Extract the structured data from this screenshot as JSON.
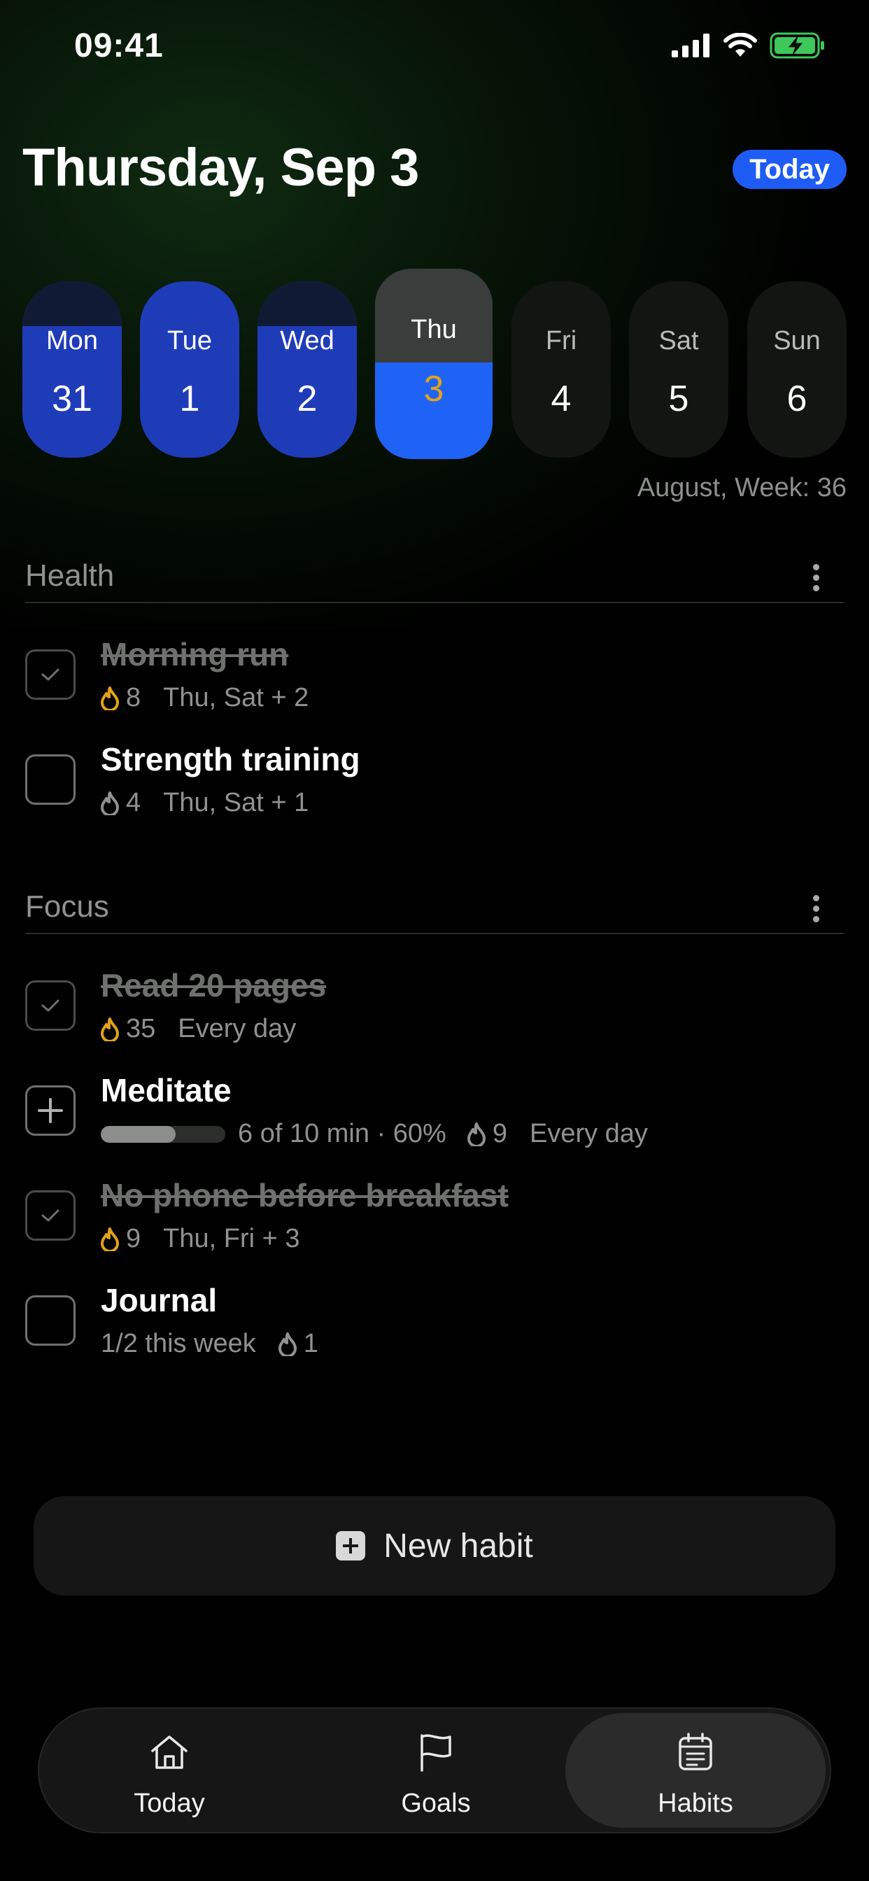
{
  "status_bar": {
    "time": "09:41"
  },
  "header": {
    "title": "Thursday, Sep 3",
    "today_button": "Today"
  },
  "week": {
    "days": [
      {
        "name": "Mon",
        "num": "31",
        "state": "done"
      },
      {
        "name": "Tue",
        "num": "1",
        "state": "done"
      },
      {
        "name": "Wed",
        "num": "2",
        "state": "done"
      },
      {
        "name": "Thu",
        "num": "3",
        "state": "selected"
      },
      {
        "name": "Fri",
        "num": "4",
        "state": "future"
      },
      {
        "name": "Sat",
        "num": "5",
        "state": "future"
      },
      {
        "name": "Sun",
        "num": "6",
        "state": "future"
      }
    ],
    "label": "August, Week: 36"
  },
  "sections": [
    {
      "title": "Health",
      "habits": [
        {
          "name": "Morning run",
          "done": true,
          "streak": "8",
          "schedule": "Thu, Sat + 2"
        },
        {
          "name": "Strength training",
          "done": false,
          "streak": "4",
          "schedule": "Thu, Sat + 1"
        }
      ]
    },
    {
      "title": "Focus",
      "habits": [
        {
          "name": "Read 20 pages",
          "done": true,
          "streak": "35",
          "schedule": "Every day"
        },
        {
          "name": "Meditate",
          "done": false,
          "progress_text": "6 of 10 min · 60%",
          "progress": 0.6,
          "streak": "9",
          "schedule": "Every day"
        },
        {
          "name": "No phone before breakfast",
          "done": true,
          "streak": "9",
          "schedule": "Thu, Fri + 3"
        },
        {
          "name": "Journal",
          "done": false,
          "weekly": "1/2 this week",
          "streak": "1"
        }
      ]
    }
  ],
  "new_habit_button": "New habit",
  "tabbar": {
    "tabs": [
      {
        "label": "Today",
        "icon": "home-icon"
      },
      {
        "label": "Goals",
        "icon": "flag-icon"
      },
      {
        "label": "Habits",
        "icon": "calendar-list-icon",
        "active": true
      }
    ]
  },
  "colors": {
    "accent_blue": "#1e63f5",
    "completed_day_blue": "#1f3cb8",
    "streak_gold": "#e3a21b",
    "muted_text": "#8f928f"
  }
}
